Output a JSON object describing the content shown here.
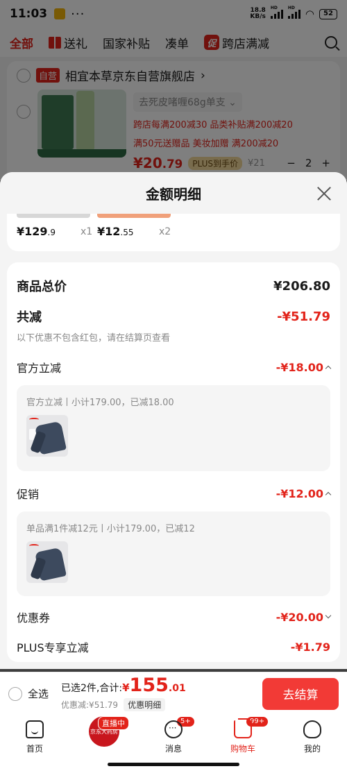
{
  "status": {
    "time": "11:03",
    "net_speed": "18.8",
    "net_unit": "KB/s",
    "hd1": "HD",
    "hd2": "HD",
    "battery": "52"
  },
  "category_tabs": [
    {
      "label": "全部",
      "active": true
    },
    {
      "label": "送礼",
      "icon": "gift-icon"
    },
    {
      "label": "国家补贴"
    },
    {
      "label": "凑单"
    },
    {
      "label": "跨店满减",
      "tag": "促"
    }
  ],
  "store": {
    "self_tag": "自营",
    "name": "相宜本草京东自营旗舰店",
    "name_arrow": "›",
    "product": {
      "spec": "去死皮啫喱68g单支",
      "promo_lines": [
        "跨店每满200减30  品类补贴满200减20",
        "满50元送赠品  美妆加赠  满200减20"
      ],
      "price_int": "¥20",
      "price_dec": ".79",
      "plus_tag": "PLUS到手价",
      "orig_price": "¥21",
      "qty": "2",
      "minus": "−",
      "plus": "+"
    }
  },
  "sheet": {
    "title": "金额明细",
    "items": [
      {
        "price_int": "¥129",
        "price_dec": ".9",
        "qty": "x1"
      },
      {
        "price_int": "¥12",
        "price_dec": ".55",
        "qty": "x2"
      }
    ],
    "total_label": "商品总价",
    "total_value": "¥206.80",
    "reduce_label": "共减",
    "reduce_value": "-¥51.79",
    "note": "以下优惠不包含红包，请在结算页查看",
    "official": {
      "label": "官方立减",
      "value": "-¥18.00",
      "detail": "官方立减丨小计179.00，已减18.00"
    },
    "promotion": {
      "label": "促销",
      "value": "-¥12.00",
      "detail": "单品满1件减12元丨小计179.00，已减12"
    },
    "coupon": {
      "label": "优惠券",
      "value": "-¥20.00"
    },
    "plus": {
      "label": "PLUS专享立减",
      "value": "-¥1.79"
    }
  },
  "checkout": {
    "select_all": "全选",
    "selected_text": "已选2件,合计:",
    "amount_cur": "¥",
    "amount_int": "155",
    "amount_dec": ".01",
    "discount_text": "优惠减:¥51.79",
    "detail_pill": "优惠明细",
    "button": "去结算"
  },
  "tabbar": {
    "home": "首页",
    "live_badge": "直播中",
    "live_center": "京东大药房",
    "messages": "消息",
    "messages_badge": "5+",
    "cart": "购物车",
    "cart_badge": "99+",
    "me": "我的"
  },
  "colors": {
    "accent": "#e2231a",
    "button": "#f23a36"
  }
}
